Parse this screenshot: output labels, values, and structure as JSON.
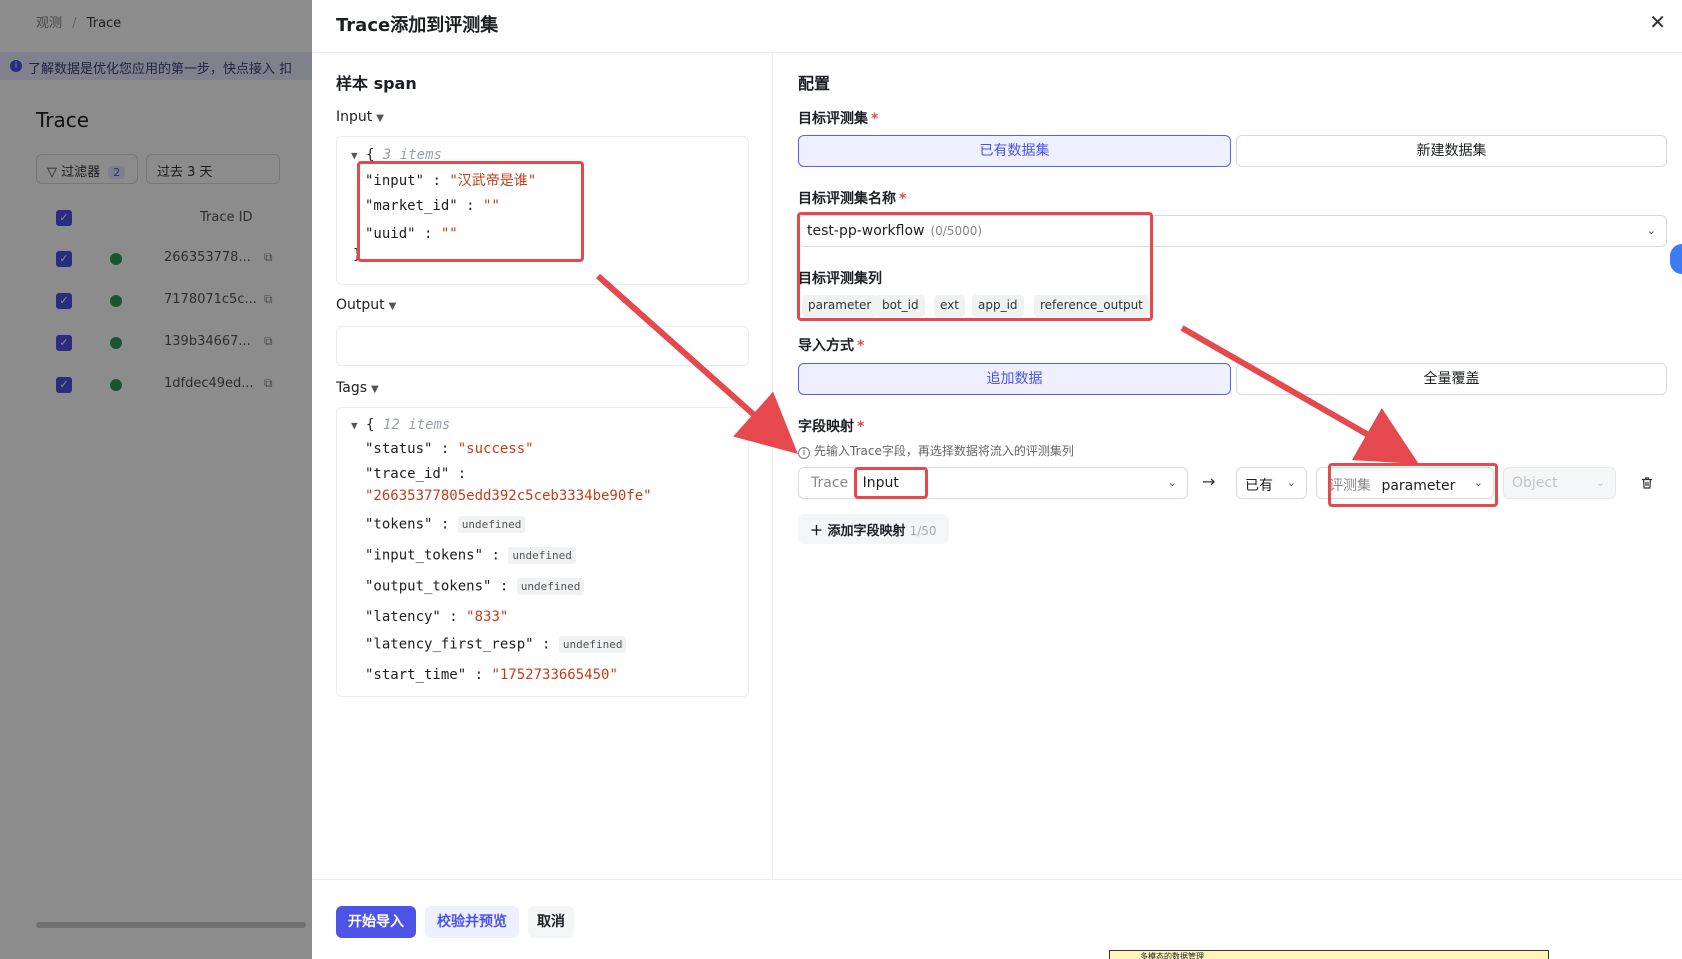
{
  "background": {
    "breadcrumb": [
      "观测",
      "Trace"
    ],
    "banner": "了解数据是优化您应用的第一步，快点接入 扣",
    "page_title": "Trace",
    "filter_label": "过滤器",
    "filter_count": "2",
    "range_label": "过去 3 天",
    "column_trace_id": "Trace ID",
    "rows": [
      "266353778...",
      "7178071c5c...",
      "139b34667...",
      "1dfdec49ed..."
    ]
  },
  "modal": {
    "title": "Trace添加到评测集"
  },
  "sample": {
    "section_title": "样本 span",
    "input_label": "Input",
    "input_json": {
      "count_label": "3 items",
      "lines": [
        {
          "key": "\"input\"",
          "value": "\"汉武帝是谁\""
        },
        {
          "key": "\"market_id\"",
          "value": "\"\""
        },
        {
          "key": "\"uuid\"",
          "value": "\"\""
        }
      ]
    },
    "output_label": "Output",
    "tags_label": "Tags",
    "tags_json": {
      "count_label": "12 items",
      "status_key": "\"status\"",
      "status_val": "\"success\"",
      "trace_id_key": "\"trace_id\"",
      "trace_id_val": "\"26635377805edd392c5ceb3334be90fe\"",
      "tokens_key": "\"tokens\"",
      "tokens_val": "undefined",
      "input_tokens_key": "\"input_tokens\"",
      "input_tokens_val": "undefined",
      "output_tokens_key": "\"output_tokens\"",
      "output_tokens_val": "undefined",
      "latency_key": "\"latency\"",
      "latency_val": "\"833\"",
      "latency_first_resp_key": "\"latency_first_resp\"",
      "latency_first_resp_val": "undefined",
      "start_time_key": "\"start_time\"",
      "start_time_val": "\"1752733665450\""
    }
  },
  "config": {
    "section_title": "配置",
    "target_dataset_label": "目标评测集",
    "dataset_options": [
      "已有数据集",
      "新建数据集"
    ],
    "dataset_name_label": "目标评测集名称",
    "dataset_name_value": "test-pp-workflow",
    "dataset_name_count": "(0/5000)",
    "columns_label": "目标评测集列",
    "columns": [
      "parameter",
      "bot_id",
      "ext",
      "app_id",
      "reference_output"
    ],
    "import_mode_label": "导入方式",
    "import_mode_options": [
      "追加数据",
      "全量覆盖"
    ],
    "mapping_label": "字段映射",
    "mapping_hint": "先输入Trace字段，再选择数据将流入的评测集列",
    "mapping": {
      "trace_prefix": "Trace",
      "trace_field": "Input",
      "existing": "已有",
      "dataset_prefix": "评测集",
      "dataset_field": "parameter",
      "type_placeholder": "Object"
    },
    "add_mapping_label": "添加字段映射",
    "add_mapping_count": "1/50"
  },
  "footer": {
    "start_import": "开始导入",
    "validate_preview": "校验并预览",
    "cancel": "取消"
  },
  "floating_tip": "多模态的数据管理",
  "colors": {
    "primary": "#4d53e8",
    "annotation_red": "#e5484d",
    "string_value": "#c53b1b"
  }
}
